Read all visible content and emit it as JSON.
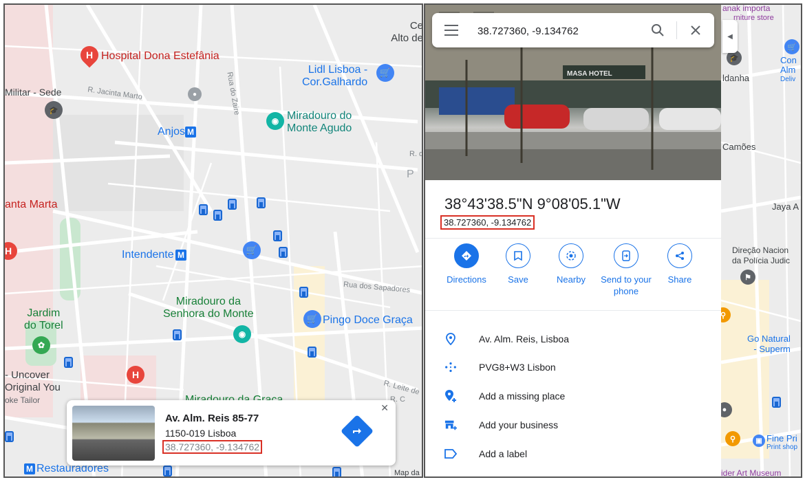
{
  "left_map": {
    "places": {
      "hospital": "Hospital Dona Estefânia",
      "lidl_1": "Lidl Lisboa -",
      "lidl_2": "Cor.Galhardo",
      "miradouro_monte_1": "Miradouro do",
      "miradouro_monte_2": "Monte Agudo",
      "militar": "Militar - Sede",
      "jacinta": "R. Jacinta Marto",
      "zaire": "Rua do Zaire",
      "anjos": "Anjos",
      "santa_marta": "anta Marta",
      "intendente": "Intendente",
      "rua_sapadores": "Rua dos Sapadores",
      "miradouro_senhora_1": "Miradouro da",
      "miradouro_senhora_2": "Senhora do Monte",
      "pingo_doce": "Pingo Doce Graça",
      "jardim_1": "Jardim",
      "jardim_2": "do Torel",
      "uncover_1": "- Uncover",
      "uncover_2": "Original You",
      "uncover_3": "oke Tailor",
      "restauradores": "Restauradores",
      "miradouro_graca": "Miradouro da Graça",
      "alto_1": "Ce",
      "alto_2": "Alto de",
      "pe": "P E",
      "r_de": "R. de",
      "leite": "R. Leite de",
      "rc": "R. C",
      "map_data": "Map da"
    },
    "metro_letter": "M",
    "hospital_letter": "H",
    "card": {
      "title": "Av. Alm. Reis 85-77",
      "subtitle": "1150-019 Lisboa",
      "coords": "38.727360, -9.134762",
      "close": "✕"
    }
  },
  "right_panel": {
    "search": {
      "value": "38.727360, -9.134762"
    },
    "photo_sign": "MASA HOTEL",
    "place_title": "38°43'38.5\"N 9°08'05.1\"W",
    "coords": "38.727360, -9.134762",
    "actions": [
      {
        "label": "Directions"
      },
      {
        "label": "Save"
      },
      {
        "label": "Nearby"
      },
      {
        "label": "Send to your phone"
      },
      {
        "label": "Share"
      }
    ],
    "rows": [
      {
        "text": "Av. Alm. Reis, Lisboa"
      },
      {
        "text": "PVG8+W3 Lisbon"
      },
      {
        "text": "Add a missing place"
      },
      {
        "text": "Add your business"
      },
      {
        "text": "Add a label"
      }
    ],
    "map_strip": {
      "importa": "anak importa",
      "furniture": "rniture store",
      "con": "Con",
      "alm": "Alm",
      "deliv": "Deliv",
      "danha": "ldanha",
      "camoes": "Camões",
      "jaya": "Jaya A",
      "direcao_1": "Direção Nacion",
      "direcao_2": "da Polícia Judic",
      "go_natural_1": "Go Natural",
      "go_natural_2": "- Superm",
      "fine_1": "Fine Pri",
      "fine_2": "Print shop",
      "art": "ider Art Museum"
    }
  },
  "colors": {
    "accent": "#1a73e8",
    "highlight": "#d93025",
    "hospital": "#e8453c",
    "teal": "#12b5a5"
  }
}
